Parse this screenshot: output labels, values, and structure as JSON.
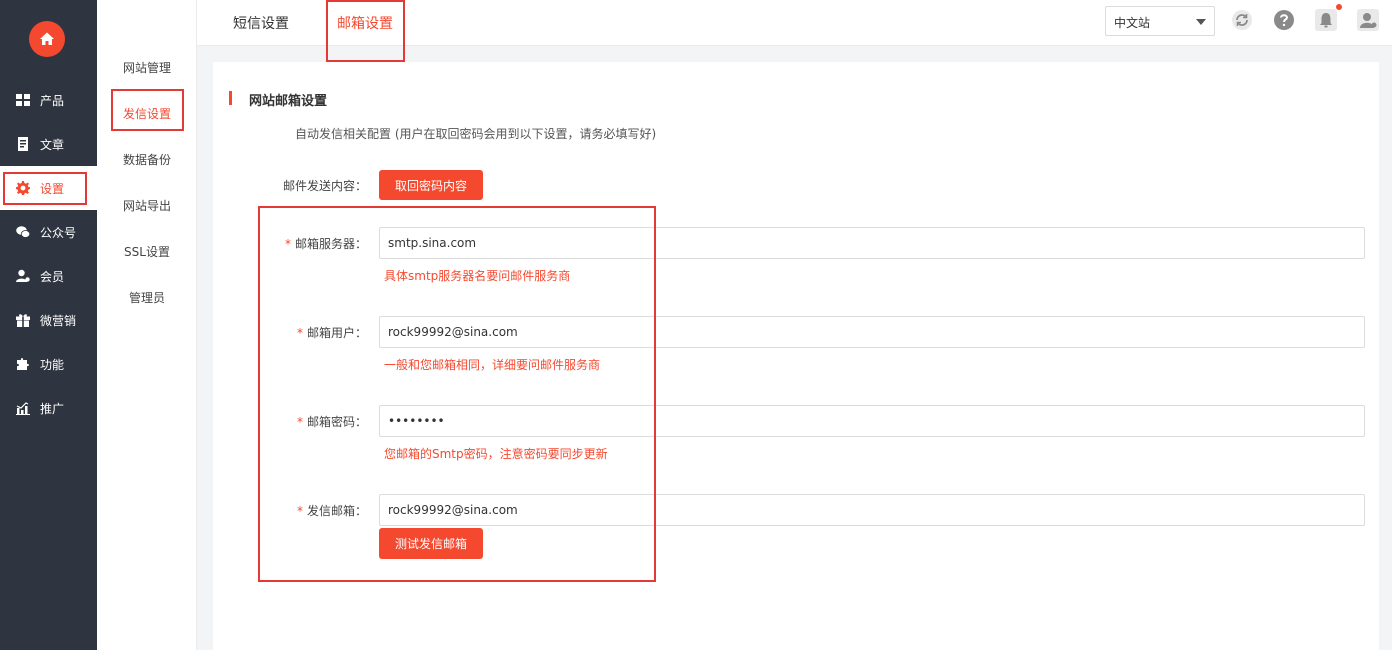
{
  "sidebar": {
    "items": [
      {
        "label": "产品",
        "icon": "grid-icon"
      },
      {
        "label": "文章",
        "icon": "document-icon"
      },
      {
        "label": "设置",
        "icon": "gear-icon"
      },
      {
        "label": "公众号",
        "icon": "wechat-icon"
      },
      {
        "label": "会员",
        "icon": "member-icon"
      },
      {
        "label": "微营销",
        "icon": "gift-icon"
      },
      {
        "label": "功能",
        "icon": "puzzle-icon"
      },
      {
        "label": "推广",
        "icon": "chart-icon"
      }
    ]
  },
  "submenu": {
    "items": [
      {
        "label": "网站管理"
      },
      {
        "label": "发信设置"
      },
      {
        "label": "数据备份"
      },
      {
        "label": "网站导出"
      },
      {
        "label": "SSL设置"
      },
      {
        "label": "管理员"
      }
    ]
  },
  "topbar": {
    "tabs": [
      {
        "label": "短信设置"
      },
      {
        "label": "邮箱设置"
      }
    ],
    "language": "中文站"
  },
  "panel": {
    "title": "网站邮箱设置",
    "description": "自动发信相关配置 (用户在取回密码会用到以下设置，请务必填写好)",
    "send_content_label": "邮件发送内容：",
    "send_content_button": "取回密码内容",
    "fields": {
      "server": {
        "label": "邮箱服务器：",
        "value": "smtp.sina.com",
        "hint": "具体smtp服务器名要问邮件服务商"
      },
      "user": {
        "label": "邮箱用户：",
        "value": "rock99992@sina.com",
        "hint": "一般和您邮箱相同，详细要问邮件服务商"
      },
      "password": {
        "label": "邮箱密码：",
        "value": "password",
        "hint": "您邮箱的Smtp密码，注意密码要同步更新"
      },
      "sender": {
        "label": "发信邮箱：",
        "value": "rock99992@sina.com"
      }
    },
    "required_mark": "*",
    "test_button": "测试发信邮箱"
  },
  "colors": {
    "accent": "#f5492f",
    "sidebar_bg": "#2f3540",
    "annotation": "#e53935"
  }
}
